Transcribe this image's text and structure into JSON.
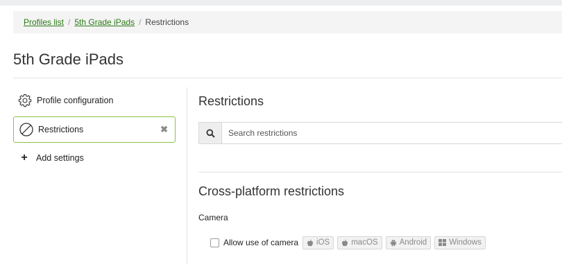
{
  "breadcrumb": {
    "items": [
      {
        "label": "Profiles list"
      },
      {
        "label": "5th Grade iPads"
      }
    ],
    "current": "Restrictions",
    "separator": "/"
  },
  "page": {
    "title": "5th Grade iPads"
  },
  "sidebar": {
    "items": [
      {
        "label": "Profile configuration",
        "icon": "gear-icon"
      },
      {
        "label": "Restrictions",
        "icon": "prohibit-icon",
        "selected": true,
        "close_glyph": "✖"
      },
      {
        "label": "Add settings",
        "icon": "plus-icon",
        "glyph": "+"
      }
    ]
  },
  "main": {
    "title": "Restrictions",
    "search": {
      "placeholder": "Search restrictions",
      "value": ""
    },
    "section": {
      "title": "Cross-platform restrictions",
      "category": "Camera",
      "option": {
        "label": "Allow use of camera",
        "checked": false,
        "platforms": [
          {
            "label": "iOS",
            "icon": "apple-icon"
          },
          {
            "label": "macOS",
            "icon": "apple-icon"
          },
          {
            "label": "Android",
            "icon": "android-icon"
          },
          {
            "label": "Windows",
            "icon": "windows-icon"
          }
        ]
      }
    }
  },
  "colors": {
    "link": "#2a7a14",
    "selected_border": "#8bc34a",
    "breadcrumb_bg": "#f4f4f4",
    "tag_bg": "#f2f2f2"
  }
}
